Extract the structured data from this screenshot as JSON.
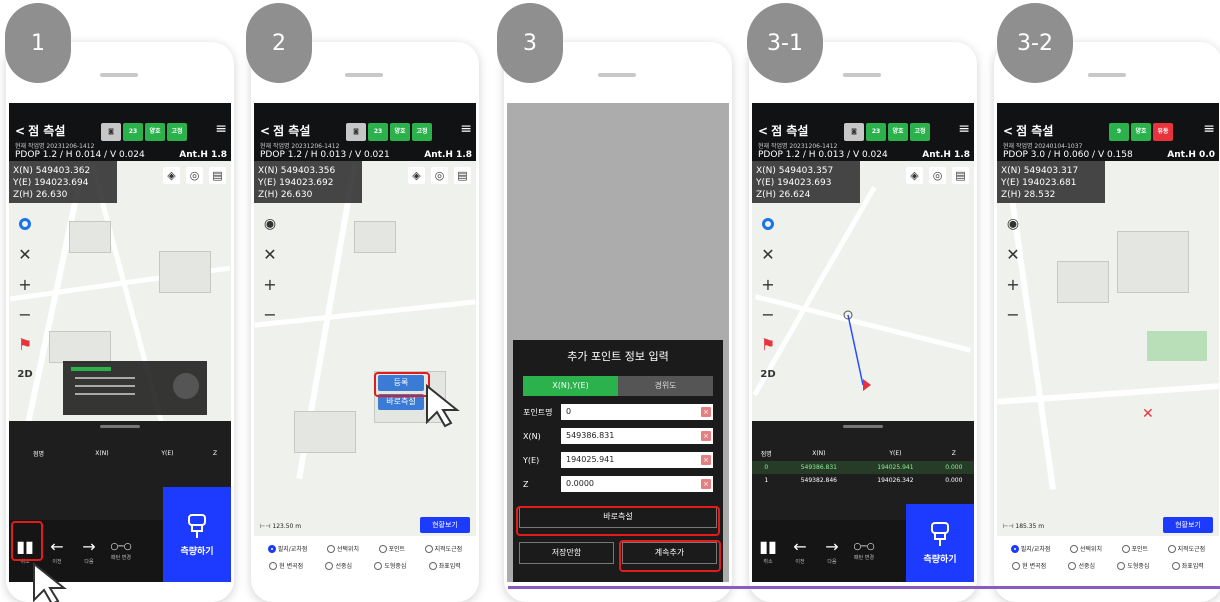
{
  "badges": [
    "1",
    "2",
    "3",
    "3-1",
    "3-2"
  ],
  "common": {
    "back_title": "점 측설",
    "menu_icon": "hamburger-icon",
    "measure_label": "측량하기",
    "nav": [
      {
        "glyph": "▮▮",
        "label": "취소"
      },
      {
        "glyph": "←",
        "label": "이전"
      },
      {
        "glyph": "→",
        "label": "다음"
      },
      {
        "glyph": "○─○",
        "label": "패턴 변경"
      }
    ],
    "radios_row1": [
      "필지/교차점",
      "선택위치",
      "포인트",
      "지적도근점"
    ],
    "radios_row2": [
      "현 변곡점",
      "선중심",
      "도형중심",
      "좌표입력"
    ]
  },
  "screens": [
    {
      "work": "현재 작업명 20231206-1412",
      "pdop": "PDOP 1.2 / H 0.014 / V 0.024",
      "anth": "Ant.H 1.8",
      "coords": [
        "X(N) 549403.362",
        "Y(E) 194023.694",
        "Z(H) 26.630"
      ],
      "pills": [
        "23",
        "양호",
        "고정"
      ],
      "table_head": [
        "점명",
        "X(N)",
        "Y(E)",
        "Z"
      ]
    },
    {
      "work": "현재 작업명 20231206-1412",
      "pdop": "PDOP 1.2 / H 0.013 / V 0.021",
      "anth": "Ant.H 1.8",
      "coords": [
        "X(N) 549403.356",
        "Y(E) 194023.692",
        "Z(H) 26.630"
      ],
      "pills": [
        "23",
        "양호",
        "고정"
      ],
      "popup_register": "등록",
      "popup_measure": "바로측설",
      "scale": "123.50 m",
      "current_view": "현황보기"
    },
    {
      "dialog_title": "추가 포인트 정보 입력",
      "tab_xy": "X(N),Y(E)",
      "tab_latlon": "경위도",
      "fields": [
        {
          "label": "포인트명",
          "value": "0"
        },
        {
          "label": "X(N)",
          "value": "549386.831"
        },
        {
          "label": "Y(E)",
          "value": "194025.941"
        },
        {
          "label": "Z",
          "value": "0.0000"
        }
      ],
      "btn_measure": "바로측설",
      "btn_save": "저장만함",
      "btn_continue": "계속추가"
    },
    {
      "work": "현재 작업명 20231206-1412",
      "pdop": "PDOP 1.2 / H 0.013 / V 0.024",
      "anth": "Ant.H 1.8",
      "coords": [
        "X(N) 549403.357",
        "Y(E) 194023.693",
        "Z(H) 26.624"
      ],
      "pills": [
        "23",
        "양호",
        "고정"
      ],
      "table_head": [
        "점명",
        "X(N)",
        "Y(E)",
        "Z"
      ],
      "rows": [
        [
          "0",
          "549386.831",
          "194025.941",
          "0.000"
        ],
        [
          "1",
          "549382.846",
          "194026.342",
          "0.000"
        ]
      ]
    },
    {
      "work": "현재 작업명 20240104-1037",
      "pdop": "PDOP 3.0 / H 0.060 / V 0.158",
      "anth": "Ant.H 0.0",
      "coords": [
        "X(N) 549403.317",
        "Y(E) 194023.681",
        "Z(H) 28.532"
      ],
      "pills": [
        "9",
        "양호",
        "유동"
      ],
      "scale": "185.35 m",
      "current_view": "현황보기"
    }
  ]
}
